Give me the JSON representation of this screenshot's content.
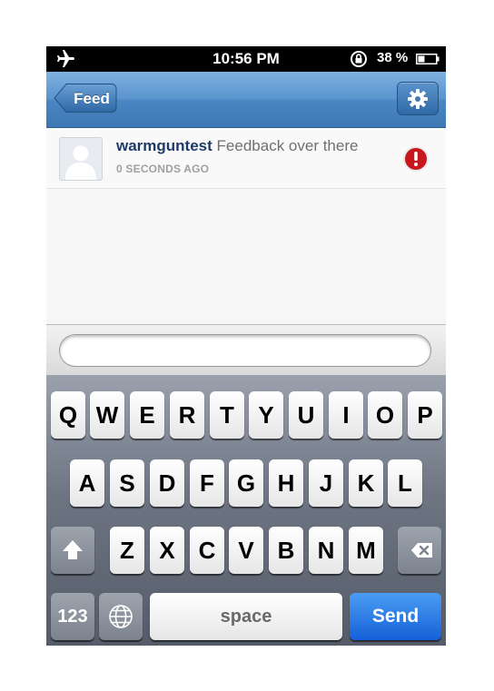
{
  "status_bar": {
    "time": "10:56 PM",
    "battery": "38 %"
  },
  "nav": {
    "back_label": "Feed",
    "settings_icon": "gear-icon"
  },
  "feed": {
    "items": [
      {
        "username": "warmguntest",
        "message": "Feedback over there",
        "timestamp": "0 SECONDS AGO",
        "status_icon": "error-icon"
      }
    ]
  },
  "input": {
    "value": "",
    "placeholder": ""
  },
  "keyboard": {
    "row1": [
      "Q",
      "W",
      "E",
      "R",
      "T",
      "Y",
      "U",
      "I",
      "O",
      "P"
    ],
    "row2": [
      "A",
      "S",
      "D",
      "F",
      "G",
      "H",
      "J",
      "K",
      "L"
    ],
    "row3": [
      "Z",
      "X",
      "C",
      "V",
      "B",
      "N",
      "M"
    ],
    "numbers_label": "123",
    "space_label": "space",
    "send_label": "Send"
  },
  "colors": {
    "nav_blue": "#4a86c3",
    "send_blue": "#1a6ee0",
    "error_red": "#c8161d",
    "username": "#1f3a66"
  }
}
